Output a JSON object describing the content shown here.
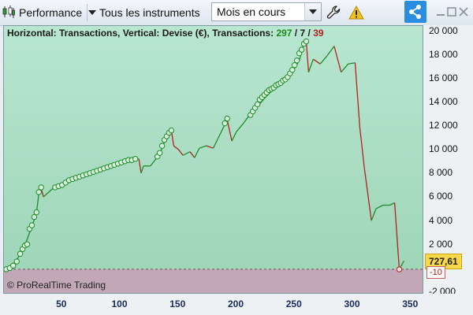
{
  "toolbar": {
    "performance_label": "Performance",
    "instruments_label": "Tous les instruments",
    "period_value": "Mois en cours"
  },
  "chart_data": {
    "type": "line",
    "title_prefix": "Horizontal: Transactions, Vertical: Devise (€), Transactions: ",
    "count_green": "297",
    "count_sep1": " / ",
    "count_neutral": "7",
    "count_sep2": " / ",
    "count_red": "39",
    "xlabel": "",
    "ylabel": "",
    "xlim": [
      0,
      360
    ],
    "ylim": [
      -2000,
      20500
    ],
    "x_ticks": [
      "50",
      "100",
      "150",
      "200",
      "250",
      "300",
      "350"
    ],
    "y_ticks": [
      "20 000",
      "18 000",
      "16 000",
      "14 000",
      "12 000",
      "10 000",
      "8 000",
      "6 000",
      "4 000",
      "2 000",
      "-2 000"
    ],
    "zero_line": 0,
    "current_value_label": "727,61",
    "low_value_label": "-10",
    "colors": {
      "up": "#1e8c2a",
      "down": "#b22222",
      "profit_bg": "#a8dcc2",
      "loss_bg": "#c4a8b4"
    },
    "series": [
      {
        "values": [
          [
            2,
            0
          ],
          [
            10,
            600
          ],
          [
            14,
            1300
          ],
          [
            18,
            2000
          ],
          [
            24,
            3600
          ],
          [
            28,
            4700
          ],
          [
            30,
            6400
          ],
          [
            32,
            6800
          ],
          [
            34,
            6100
          ],
          [
            42,
            6800
          ],
          [
            48,
            7100
          ],
          [
            54,
            7500
          ],
          [
            60,
            7700
          ],
          [
            70,
            8000
          ],
          [
            80,
            8300
          ],
          [
            90,
            8600
          ],
          [
            100,
            8900
          ],
          [
            110,
            9200
          ],
          [
            116,
            9300
          ],
          [
            118,
            8100
          ],
          [
            120,
            8700
          ],
          [
            126,
            8700
          ],
          [
            134,
            9700
          ],
          [
            140,
            11200
          ],
          [
            144,
            11700
          ],
          [
            146,
            10400
          ],
          [
            150,
            10100
          ],
          [
            154,
            9600
          ],
          [
            160,
            9900
          ],
          [
            164,
            9400
          ],
          [
            168,
            10200
          ],
          [
            174,
            10400
          ],
          [
            180,
            10200
          ],
          [
            184,
            11000
          ],
          [
            188,
            11800
          ],
          [
            192,
            12600
          ],
          [
            196,
            10800
          ],
          [
            200,
            11600
          ],
          [
            206,
            12300
          ],
          [
            212,
            13100
          ],
          [
            218,
            13700
          ],
          [
            224,
            14400
          ],
          [
            230,
            15000
          ],
          [
            236,
            15400
          ],
          [
            242,
            15800
          ],
          [
            248,
            16600
          ],
          [
            254,
            17600
          ],
          [
            258,
            19000
          ],
          [
            260,
            19200
          ],
          [
            262,
            16600
          ],
          [
            266,
            17700
          ],
          [
            272,
            17300
          ],
          [
            278,
            18000
          ],
          [
            284,
            18800
          ],
          [
            290,
            16600
          ],
          [
            296,
            17300
          ],
          [
            302,
            17400
          ],
          [
            306,
            12000
          ],
          [
            310,
            8500
          ],
          [
            316,
            4100
          ],
          [
            320,
            5100
          ],
          [
            326,
            5400
          ],
          [
            332,
            5400
          ],
          [
            336,
            5600
          ],
          [
            340,
            -10
          ],
          [
            344,
            700
          ]
        ]
      }
    ],
    "markers": [
      [
        2,
        0
      ],
      [
        5,
        100
      ],
      [
        8,
        300
      ],
      [
        11,
        650
      ],
      [
        14,
        1300
      ],
      [
        16,
        1700
      ],
      [
        18,
        2000
      ],
      [
        20,
        2100
      ],
      [
        22,
        3400
      ],
      [
        24,
        3700
      ],
      [
        26,
        4400
      ],
      [
        28,
        4800
      ],
      [
        30,
        6500
      ],
      [
        32,
        6900
      ],
      [
        44,
        6900
      ],
      [
        47,
        7000
      ],
      [
        50,
        7100
      ],
      [
        53,
        7300
      ],
      [
        56,
        7500
      ],
      [
        59,
        7600
      ],
      [
        62,
        7700
      ],
      [
        65,
        7800
      ],
      [
        68,
        7900
      ],
      [
        71,
        8000
      ],
      [
        74,
        8100
      ],
      [
        77,
        8200
      ],
      [
        80,
        8300
      ],
      [
        83,
        8400
      ],
      [
        86,
        8500
      ],
      [
        89,
        8600
      ],
      [
        92,
        8700
      ],
      [
        95,
        8800
      ],
      [
        98,
        8900
      ],
      [
        101,
        9000
      ],
      [
        104,
        9100
      ],
      [
        107,
        9200
      ],
      [
        110,
        9200
      ],
      [
        113,
        9300
      ],
      [
        132,
        9500
      ],
      [
        134,
        9800
      ],
      [
        136,
        10400
      ],
      [
        138,
        10900
      ],
      [
        140,
        11200
      ],
      [
        142,
        11500
      ],
      [
        144,
        11700
      ],
      [
        190,
        12300
      ],
      [
        192,
        12700
      ],
      [
        212,
        13000
      ],
      [
        214,
        13300
      ],
      [
        216,
        13600
      ],
      [
        218,
        13900
      ],
      [
        220,
        14300
      ],
      [
        222,
        14500
      ],
      [
        224,
        14700
      ],
      [
        226,
        14900
      ],
      [
        228,
        15100
      ],
      [
        230,
        15200
      ],
      [
        232,
        15300
      ],
      [
        234,
        15500
      ],
      [
        236,
        15600
      ],
      [
        238,
        15700
      ],
      [
        240,
        15900
      ],
      [
        242,
        16000
      ],
      [
        244,
        16200
      ],
      [
        246,
        16500
      ],
      [
        248,
        16800
      ],
      [
        250,
        17200
      ],
      [
        252,
        17600
      ],
      [
        254,
        18200
      ],
      [
        256,
        18500
      ],
      [
        258,
        19000
      ],
      [
        260,
        19200
      ]
    ],
    "low_marker": [
      340,
      -10
    ]
  }
}
